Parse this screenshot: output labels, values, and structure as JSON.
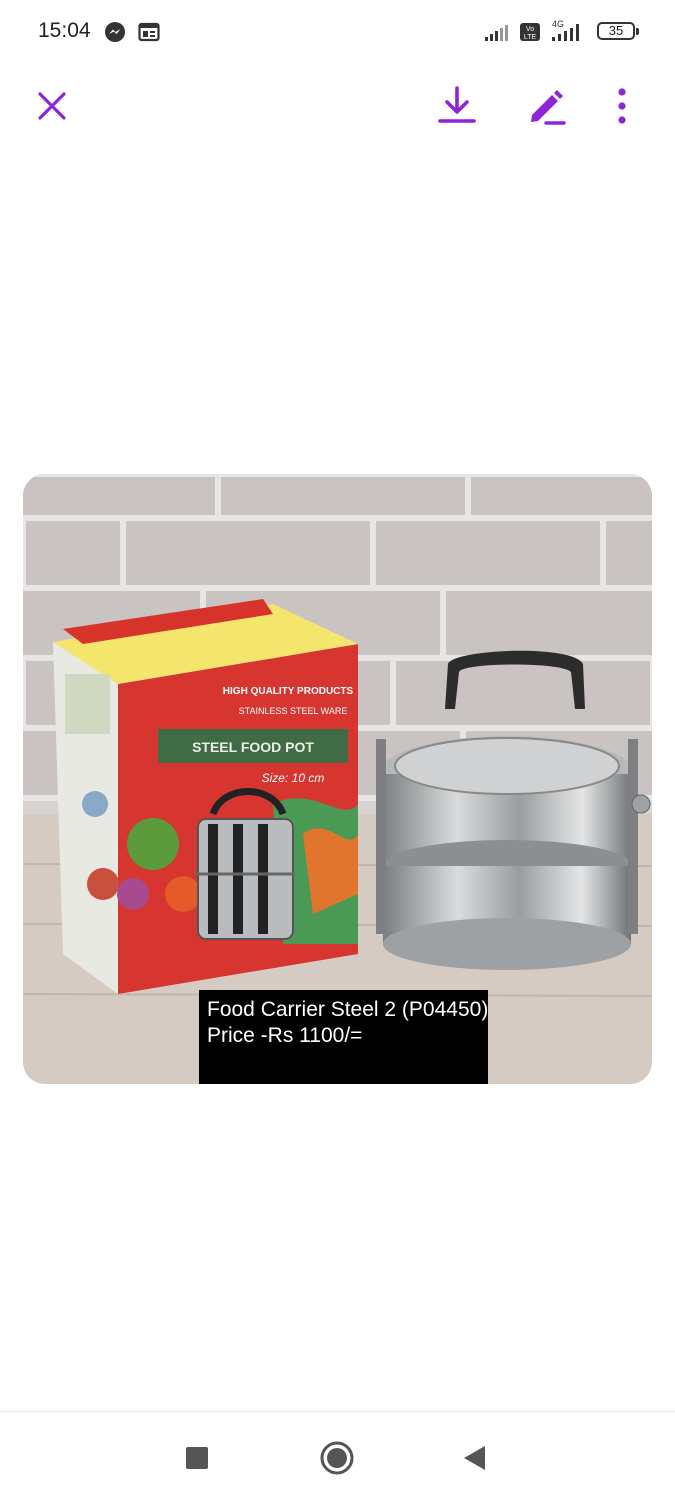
{
  "status_bar": {
    "time": "15:04",
    "network_label": "4G",
    "volte_label": "Vo LTE",
    "battery_level": "35"
  },
  "toolbar": {
    "close_icon": "close-icon",
    "download_icon": "download-icon",
    "edit_icon": "edit-pencil-icon",
    "more_icon": "more-vertical-icon",
    "accent_color": "#8e24d6"
  },
  "viewer": {
    "caption_line1": "Food Carrier Steel 2 (P04450)",
    "caption_line2": "Price -Rs 1100/=",
    "box_label_1": "HIGH QUALITY PRODUCTS",
    "box_label_2": "STAINLESS STEEL WARE",
    "box_size_label": "Size: 10 cm"
  },
  "nav_bar": {
    "recents_icon": "square-recents-icon",
    "home_icon": "circle-home-icon",
    "back_icon": "triangle-back-icon"
  }
}
